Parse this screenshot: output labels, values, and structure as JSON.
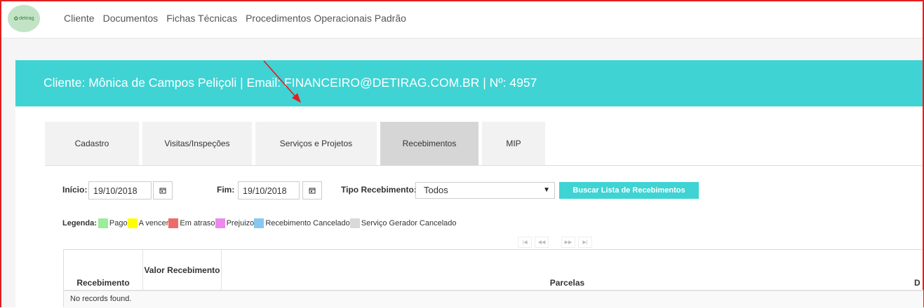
{
  "brand": {
    "logo_text": "detirag"
  },
  "nav": {
    "items": [
      "Cliente",
      "Documentos",
      "Fichas Técnicas",
      "Procedimentos Operacionais Padrão"
    ]
  },
  "banner": {
    "title": "Cliente: Mônica de Campos Peliçoli | Email: FINANCEIRO@DETIRAG.COM.BR | Nº: 4957"
  },
  "tabs": [
    {
      "label": "Cadastro",
      "active": false
    },
    {
      "label": "Visitas/Inspeções",
      "active": false
    },
    {
      "label": "Serviços e Projetos",
      "active": false
    },
    {
      "label": "Recebimentos",
      "active": true
    },
    {
      "label": "MIP",
      "active": false
    }
  ],
  "filters": {
    "start_label": "Início:",
    "start_value": "19/10/2018",
    "end_label": "Fim:",
    "end_value": "19/10/2018",
    "type_label": "Tipo Recebimento:",
    "type_value": "Todos",
    "search_button": "Buscar Lista de Recebimentos"
  },
  "legend": {
    "title": "Legenda:",
    "items": [
      {
        "label": "Pago",
        "color": "#99ee99"
      },
      {
        "label": "A vencer",
        "color": "#ffff00"
      },
      {
        "label": "Em atraso",
        "color": "#f06a6a"
      },
      {
        "label": "Prejuizo",
        "color": "#ee88ee"
      },
      {
        "label": "Recebimento Cancelado",
        "color": "#88c8ee"
      },
      {
        "label": "Serviço Gerador Cancelado",
        "color": "#d9d9d9"
      }
    ]
  },
  "pager": {
    "first": "|◀",
    "prev": "◀◀",
    "next": "▶▶",
    "last": "▶|"
  },
  "table": {
    "columns": [
      "Recebimento",
      "Valor Recebimento",
      "Parcelas",
      "D"
    ],
    "empty_message": "No records found."
  },
  "colors": {
    "accent": "#3fd3d4",
    "annotation_arrow": "#e02020"
  }
}
